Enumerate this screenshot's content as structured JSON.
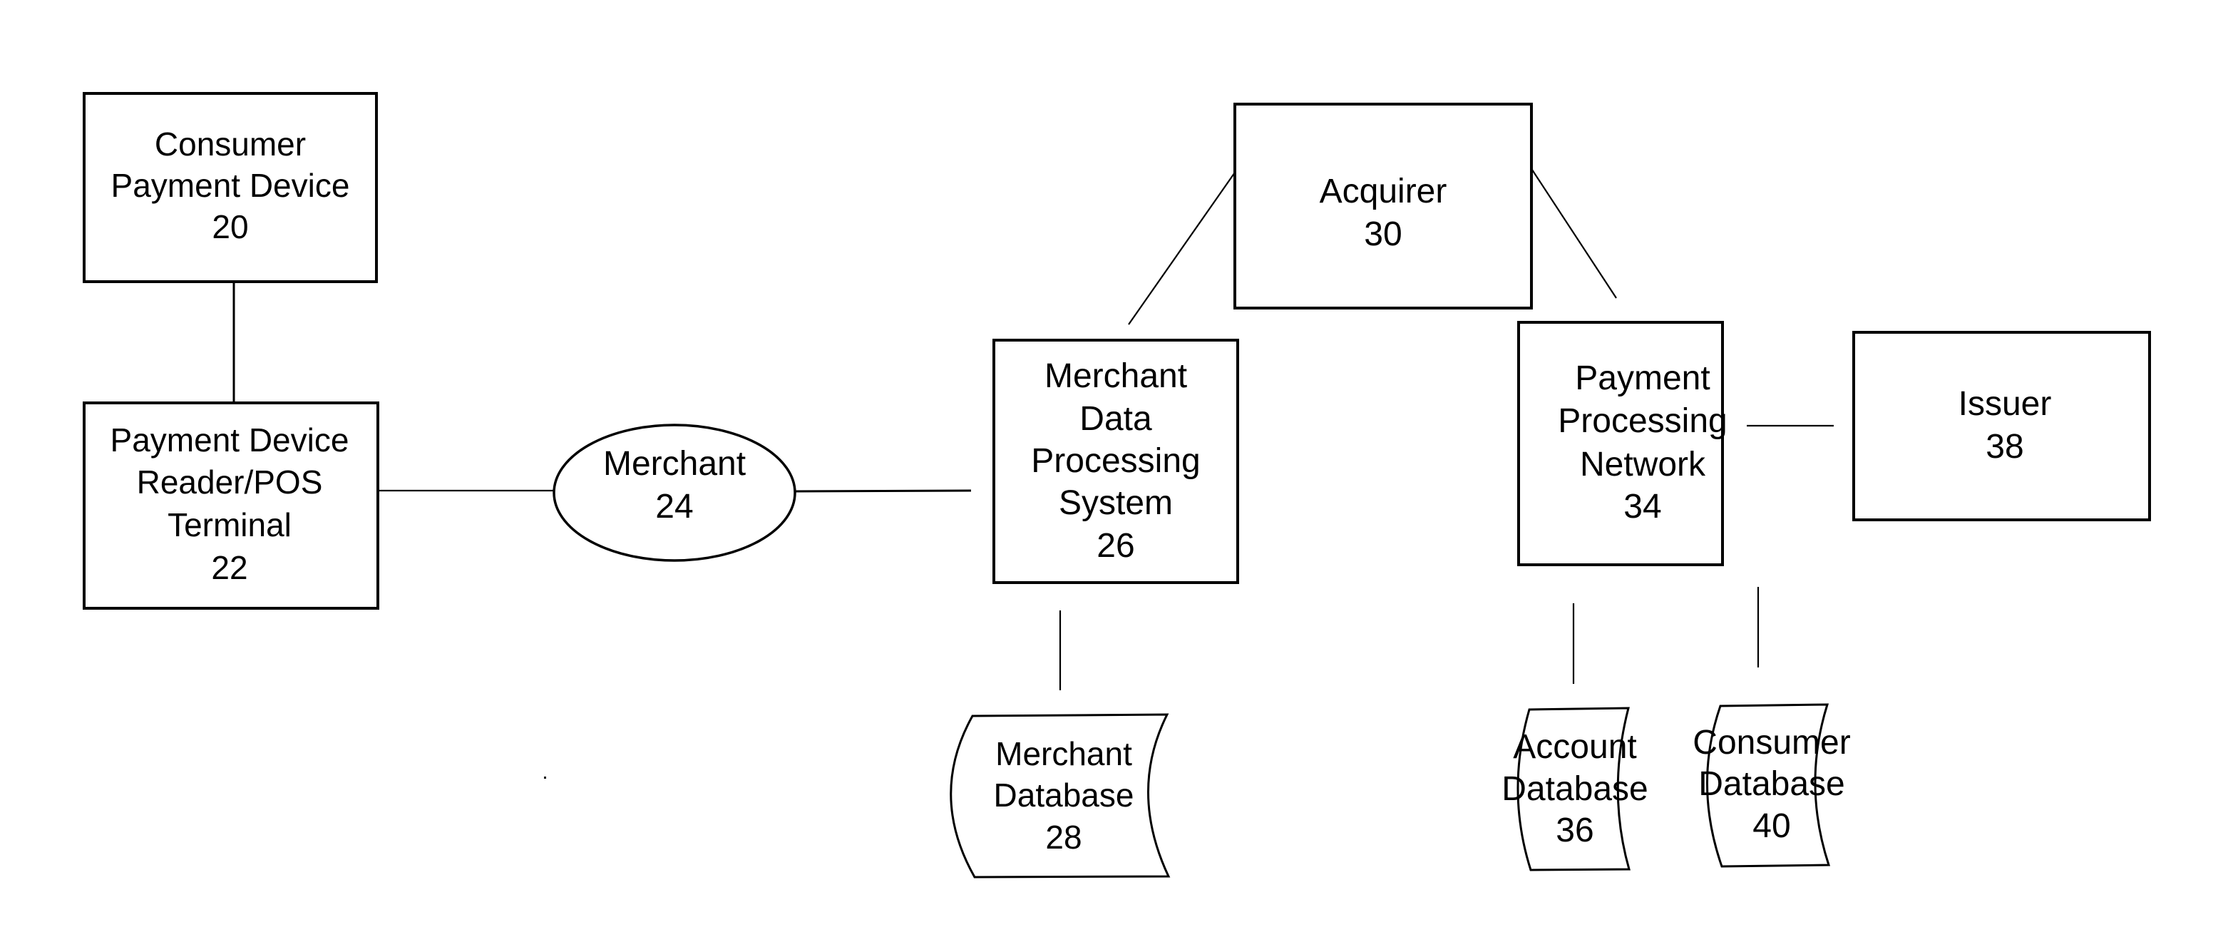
{
  "figure": {
    "type": "block diagram",
    "subject": "Payment transaction processing system"
  },
  "nodes": {
    "consumer_payment_device": {
      "lines": [
        "Consumer",
        "Payment Device",
        "20"
      ],
      "shape": "rectangle"
    },
    "pos_terminal": {
      "lines": [
        "Payment Device",
        "Reader/POS",
        "Terminal",
        "22"
      ],
      "shape": "rectangle"
    },
    "merchant": {
      "lines": [
        "Merchant",
        "24"
      ],
      "shape": "ellipse"
    },
    "merchant_data_processing": {
      "lines": [
        "Merchant",
        "Data",
        "Processing",
        "System",
        "26"
      ],
      "shape": "rectangle"
    },
    "merchant_database": {
      "lines": [
        "Merchant",
        "Database",
        "28"
      ],
      "shape": "stored-data"
    },
    "acquirer": {
      "lines": [
        "Acquirer",
        "30"
      ],
      "shape": "rectangle"
    },
    "payment_processing_network": {
      "lines": [
        "Payment",
        "Processing",
        "Network",
        "34"
      ],
      "shape": "rectangle"
    },
    "account_database": {
      "lines": [
        "Account",
        "Database",
        "36"
      ],
      "shape": "stored-data"
    },
    "issuer": {
      "lines": [
        "Issuer",
        "38"
      ],
      "shape": "rectangle"
    },
    "consumer_database": {
      "lines": [
        "Consumer",
        "Database",
        "40"
      ],
      "shape": "stored-data"
    }
  },
  "edges": [
    {
      "from": "consumer_payment_device",
      "to": "pos_terminal"
    },
    {
      "from": "pos_terminal",
      "to": "merchant"
    },
    {
      "from": "merchant",
      "to": "merchant_data_processing"
    },
    {
      "from": "merchant_data_processing",
      "to": "acquirer"
    },
    {
      "from": "acquirer",
      "to": "payment_processing_network"
    },
    {
      "from": "payment_processing_network",
      "to": "issuer"
    },
    {
      "from": "merchant_data_processing",
      "to": "merchant_database"
    },
    {
      "from": "payment_processing_network",
      "to": "account_database"
    },
    {
      "from": "issuer",
      "to": "consumer_database"
    }
  ]
}
